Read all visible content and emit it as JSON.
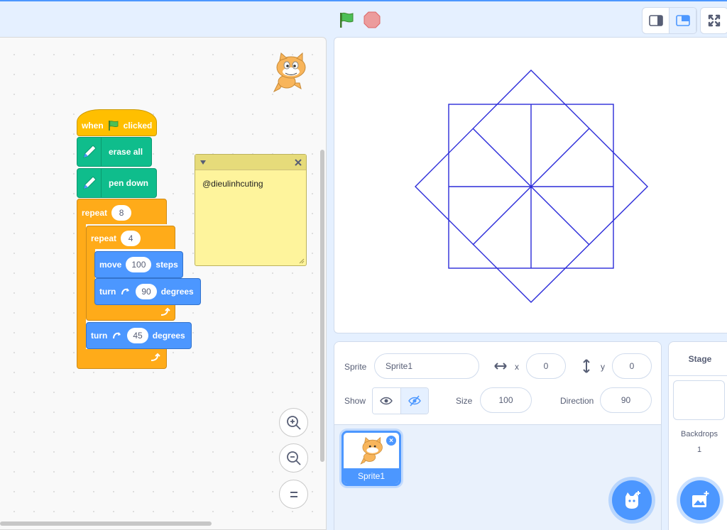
{
  "colors": {
    "accent": "#4c97ff",
    "events": "#ffbf00",
    "pen": "#0fbd8c",
    "control": "#ffab19",
    "motion": "#4c97ff",
    "pen_line": "#2b2bd9",
    "comment": "#fef49c"
  },
  "topbar": {
    "green_flag_icon": "green-flag-icon",
    "stop_icon": "stop-icon",
    "small_stage_icon": "small-stage-icon",
    "normal_stage_icon": "normal-stage-icon",
    "fullscreen_icon": "fullscreen-icon"
  },
  "script": {
    "hat": {
      "when": "when",
      "clicked": "clicked"
    },
    "erase_all": "erase all",
    "pen_down": "pen down",
    "outer_repeat": {
      "label": "repeat",
      "times": "8"
    },
    "inner_repeat": {
      "label": "repeat",
      "times": "4"
    },
    "move": {
      "label": "move",
      "steps": "100",
      "unit": "steps"
    },
    "turn_inner": {
      "label": "turn",
      "degrees": "90",
      "unit": "degrees"
    },
    "turn_outer": {
      "label": "turn",
      "degrees": "45",
      "unit": "degrees"
    }
  },
  "comment": {
    "text": "@dieulinhcuting"
  },
  "sprite_info": {
    "sprite_label": "Sprite",
    "sprite_name": "Sprite1",
    "x_label": "x",
    "x_value": "0",
    "y_label": "y",
    "y_value": "0",
    "show_label": "Show",
    "size_label": "Size",
    "size_value": "100",
    "direction_label": "Direction",
    "direction_value": "90"
  },
  "sprite_list": [
    {
      "name": "Sprite1"
    }
  ],
  "stage_pane": {
    "title": "Stage",
    "backdrops_label": "Backdrops",
    "backdrops_count": "1"
  }
}
